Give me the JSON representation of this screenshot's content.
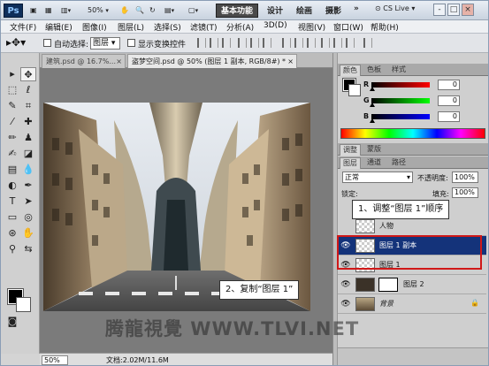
{
  "app": {
    "logo": "Ps",
    "zoom_select": "50%",
    "workspaces": {
      "active": "基本功能",
      "items": [
        "设计",
        "绘画",
        "摄影"
      ],
      "more": "»"
    },
    "cslive": "CS Live",
    "window_controls": [
      "-",
      "□",
      "×"
    ]
  },
  "menu": [
    "文件(F)",
    "编辑(E)",
    "图像(I)",
    "图层(L)",
    "选择(S)",
    "滤镜(T)",
    "分析(A)",
    "3D(D)",
    "视图(V)",
    "窗口(W)",
    "帮助(H)"
  ],
  "options": {
    "auto_select_label": "自动选择:",
    "auto_select_value": "图层",
    "show_transform_label": "显示变换控件"
  },
  "doc_tabs": [
    {
      "label": "建筑.psd @ 16.7%...",
      "close": "×"
    },
    {
      "label": "盗梦空间.psd @ 50% (图层 1 副本, RGB/8#) *",
      "close": "×"
    }
  ],
  "status": {
    "zoom": "50%",
    "doc_info": "文档:2.02M/11.6M"
  },
  "color_panel": {
    "tabs": [
      "颜色",
      "色板",
      "样式"
    ],
    "channels": [
      {
        "label": "R",
        "value": "0"
      },
      {
        "label": "G",
        "value": "0"
      },
      {
        "label": "B",
        "value": "0"
      }
    ]
  },
  "adjust_tabs": [
    "调整",
    "蒙版"
  ],
  "layers_panel": {
    "tabs": [
      "图层",
      "通道",
      "路径"
    ],
    "blend_mode": "正常",
    "opacity_label": "不透明度:",
    "opacity": "100%",
    "lock_label": "锁定:",
    "fill_label": "填充:",
    "fill": "100%",
    "layers": [
      {
        "name": "人物",
        "visible": false
      },
      {
        "name": "图层 1 副本",
        "visible": true,
        "selected": true
      },
      {
        "name": "图层 1",
        "visible": true
      },
      {
        "name": "图层 2",
        "visible": true
      },
      {
        "name": "背景",
        "visible": true,
        "locked": true
      }
    ]
  },
  "callouts": {
    "step1": "1、调整“图层 1”顺序",
    "step2": "2、复制“图层 1”"
  },
  "watermark": "腾龍視覺 WWW.TLVI.NET"
}
